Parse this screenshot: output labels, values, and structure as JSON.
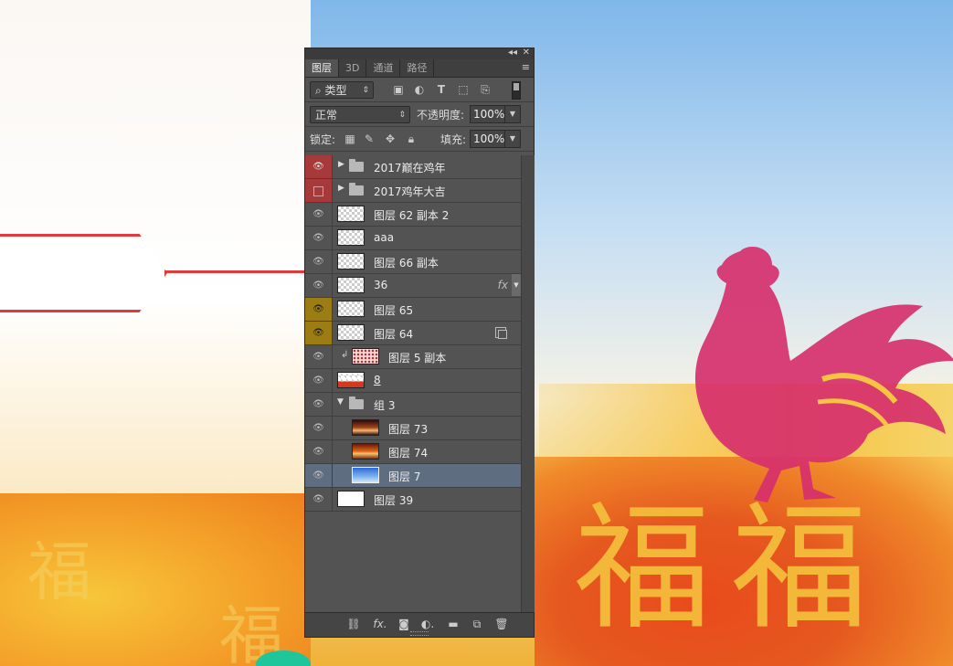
{
  "panel": {
    "collapse_label": "◂◂",
    "close_label": "✕",
    "menu_label": "≡",
    "tabs": [
      {
        "label": "图层",
        "active": true
      },
      {
        "label": "3D",
        "active": false
      },
      {
        "label": "通道",
        "active": false
      },
      {
        "label": "路径",
        "active": false
      }
    ],
    "filter": {
      "kind_label": "类型",
      "icons": [
        "image-filter-icon",
        "adjustment-filter-icon",
        "type-filter-icon",
        "shape-filter-icon",
        "smart-object-filter-icon"
      ]
    },
    "blend": {
      "mode": "正常",
      "opacity_label": "不透明度:",
      "opacity_value": "100%"
    },
    "lock": {
      "label": "锁定:",
      "fill_label": "填充:",
      "fill_value": "100%"
    },
    "layers": [
      {
        "name": "2017巅在鸡年",
        "type": "group",
        "eye": "red",
        "visible": true,
        "expanded": false,
        "indent": 0
      },
      {
        "name": "2017鸡年大吉",
        "type": "group",
        "eye": "red",
        "visible": false,
        "expanded": false,
        "indent": 0
      },
      {
        "name": "图层 62 副本 2",
        "type": "layer",
        "thumb": "trans",
        "visible": true,
        "indent": 0
      },
      {
        "name": "aaa",
        "type": "layer",
        "thumb": "trans",
        "visible": true,
        "indent": 0
      },
      {
        "name": "图层 66 副本",
        "type": "layer",
        "thumb": "trans",
        "visible": true,
        "indent": 0
      },
      {
        "name": "36",
        "type": "layer",
        "thumb": "trans",
        "visible": true,
        "indent": 0,
        "fx": "fx"
      },
      {
        "name": "图层 65",
        "type": "layer",
        "thumb": "trans",
        "eye": "yellow",
        "visible": true,
        "indent": 0
      },
      {
        "name": "图层 64",
        "type": "layer",
        "thumb": "trans",
        "eye": "yellow",
        "visible": true,
        "indent": 0,
        "smart": true
      },
      {
        "name": "图层 5 副本",
        "type": "layer",
        "thumb": "dots",
        "visible": true,
        "indent": 1,
        "clipped": true
      },
      {
        "name": "8",
        "type": "layer",
        "thumb": "half",
        "visible": true,
        "indent": 0,
        "underline": true
      },
      {
        "name": "组 3",
        "type": "group",
        "visible": true,
        "expanded": true,
        "indent": 0
      },
      {
        "name": "图层 73",
        "type": "layer",
        "thumb": "fire1",
        "visible": true,
        "indent": 1
      },
      {
        "name": "图层 74",
        "type": "layer",
        "thumb": "fire2",
        "visible": true,
        "indent": 1
      },
      {
        "name": "图层 7",
        "type": "layer",
        "thumb": "sky",
        "visible": true,
        "indent": 1,
        "selected": true
      },
      {
        "name": "图层 39",
        "type": "layer",
        "thumb": "white",
        "visible": true,
        "indent": 0
      }
    ],
    "bottom_icons": [
      "link-icon",
      "fx-icon",
      "mask-icon",
      "adjustment-icon",
      "new-group-icon",
      "new-layer-icon",
      "trash-icon"
    ]
  }
}
